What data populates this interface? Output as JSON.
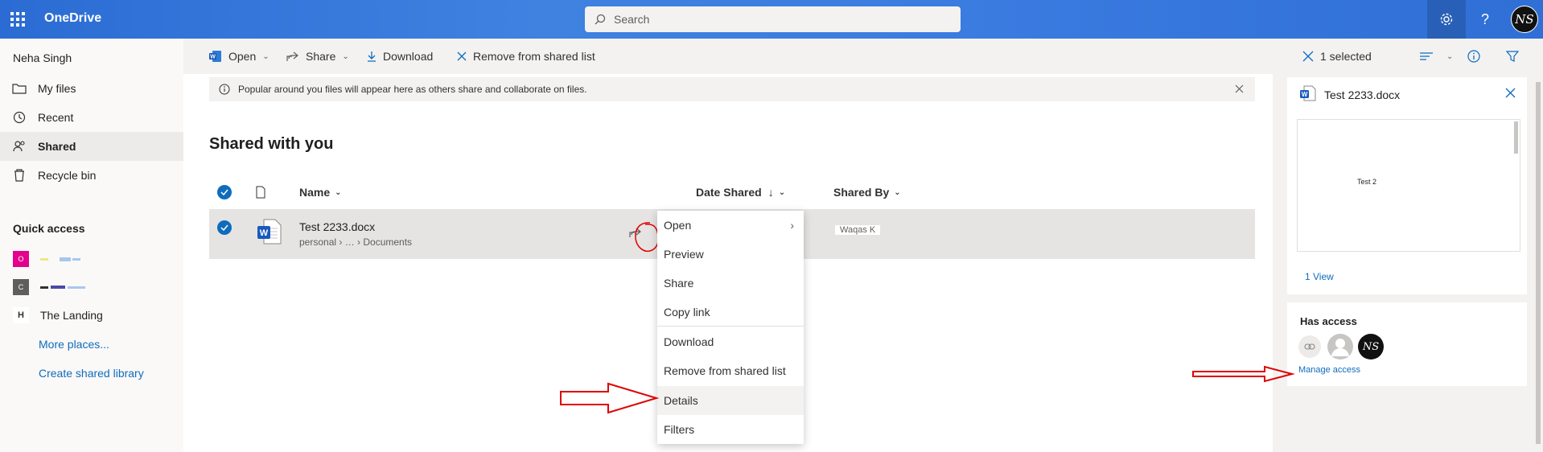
{
  "header": {
    "app_name": "OneDrive",
    "search_placeholder": "Search",
    "avatar_initials": "NS"
  },
  "sidebar": {
    "user_name": "Neha Singh",
    "nav": [
      {
        "label": "My files",
        "icon": "folder-icon"
      },
      {
        "label": "Recent",
        "icon": "clock-icon"
      },
      {
        "label": "Shared",
        "icon": "people-icon"
      },
      {
        "label": "Recycle bin",
        "icon": "recycle-bin-icon"
      }
    ],
    "quick_access_title": "Quick access",
    "quick_access": [
      {
        "label": "",
        "badge": "O",
        "color": "#e3008c"
      },
      {
        "label": "",
        "badge": "C",
        "color": "#605e5c"
      },
      {
        "label": "The Landing",
        "badge": "H",
        "color": "#ffffff"
      }
    ],
    "more_places": "More places...",
    "create_library": "Create shared library"
  },
  "commandbar": {
    "open": "Open",
    "share": "Share",
    "download": "Download",
    "remove": "Remove from shared list",
    "selected": "1 selected"
  },
  "infobar": {
    "text": "Popular around you files will appear here as others share and collaborate on files."
  },
  "page": {
    "title": "Shared with you"
  },
  "list": {
    "columns": {
      "name": "Name",
      "date_shared": "Date Shared",
      "shared_by": "Shared By"
    },
    "rows": [
      {
        "name": "Test 2233.docx",
        "path": "personal › … › Documents",
        "shared_by": "Waqas K"
      }
    ]
  },
  "context_menu": {
    "items": [
      "Open",
      "Preview",
      "Share",
      "Copy link",
      "Download",
      "Remove from shared list",
      "Details",
      "Filters"
    ]
  },
  "details": {
    "file_name": "Test 2233.docx",
    "preview_text": "Test 2",
    "views": "1 View",
    "has_access": "Has access",
    "manage_access": "Manage access",
    "owner_initials": "NS"
  },
  "colors": {
    "accent": "#0f6cbd",
    "header": "#3a7be0",
    "annotation": "#e00000"
  }
}
